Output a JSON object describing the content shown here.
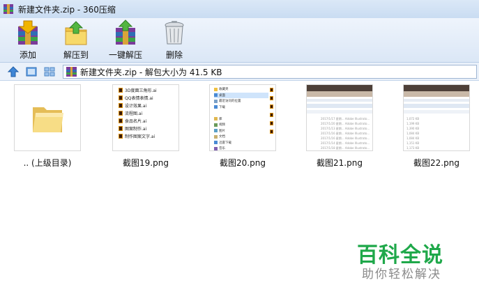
{
  "window": {
    "title": "新建文件夹.zip - 360压缩"
  },
  "toolbar": {
    "buttons": [
      {
        "label": "添加",
        "icon": "add-archive-icon"
      },
      {
        "label": "解压到",
        "icon": "extract-folder-icon"
      },
      {
        "label": "一键解压",
        "icon": "one-click-extract-icon"
      },
      {
        "label": "删除",
        "icon": "trash-can-icon"
      }
    ]
  },
  "address_bar": {
    "path": "新建文件夹.zip - 解包大小为 41.5 KB"
  },
  "files": [
    {
      "name": ".. (上级目录)",
      "kind": "folder"
    },
    {
      "name": "截图19.png",
      "kind": "image"
    },
    {
      "name": "截图20.png",
      "kind": "image"
    },
    {
      "name": "截图21.png",
      "kind": "image"
    },
    {
      "name": "截图22.png",
      "kind": "image"
    }
  ],
  "thumb19": {
    "items": [
      "3D度面三角形.ai",
      "QQ表情表情.ai",
      "设计效果.ai",
      "流程图.ai",
      "食品名片.ai",
      "图案制作.ai",
      "制作图案文字.ai"
    ]
  },
  "thumb20": {
    "rows": [
      "收藏夹",
      "桌面",
      "最近访问的位置",
      "下载",
      "",
      "库",
      "视频",
      "图片",
      "文档",
      "迅雷下载",
      "音乐"
    ]
  },
  "thumb21": {
    "rows": [
      "2017/1/17 星期... Adobe Illustrato...",
      "2017/1/20 星期... Adobe Illustrato...",
      "2017/1/13 星期... Adobe Illustrato...",
      "2017/1/16 星期... Adobe Illustrato...",
      "2017/1/16 星期... Adobe Illustrato...",
      "2017/1/14 星期... Adobe Illustrato...",
      "2017/1/18 星期... Adobe Illustrato..."
    ]
  },
  "thumb22": {
    "rows": [
      "1,072 KB",
      "1,199 KB",
      "1,390 KB",
      "1,084 KB",
      "1,084 KB",
      "1,151 KB",
      "1,173 KB"
    ]
  },
  "watermark": {
    "title": "百科全说",
    "subtitle": "助你轻松解决"
  },
  "colors": {
    "watermark_green": "#1fa84a",
    "toolbar_bg": "#dbe7f6",
    "titlebar_bg": "#c9dcf2"
  }
}
